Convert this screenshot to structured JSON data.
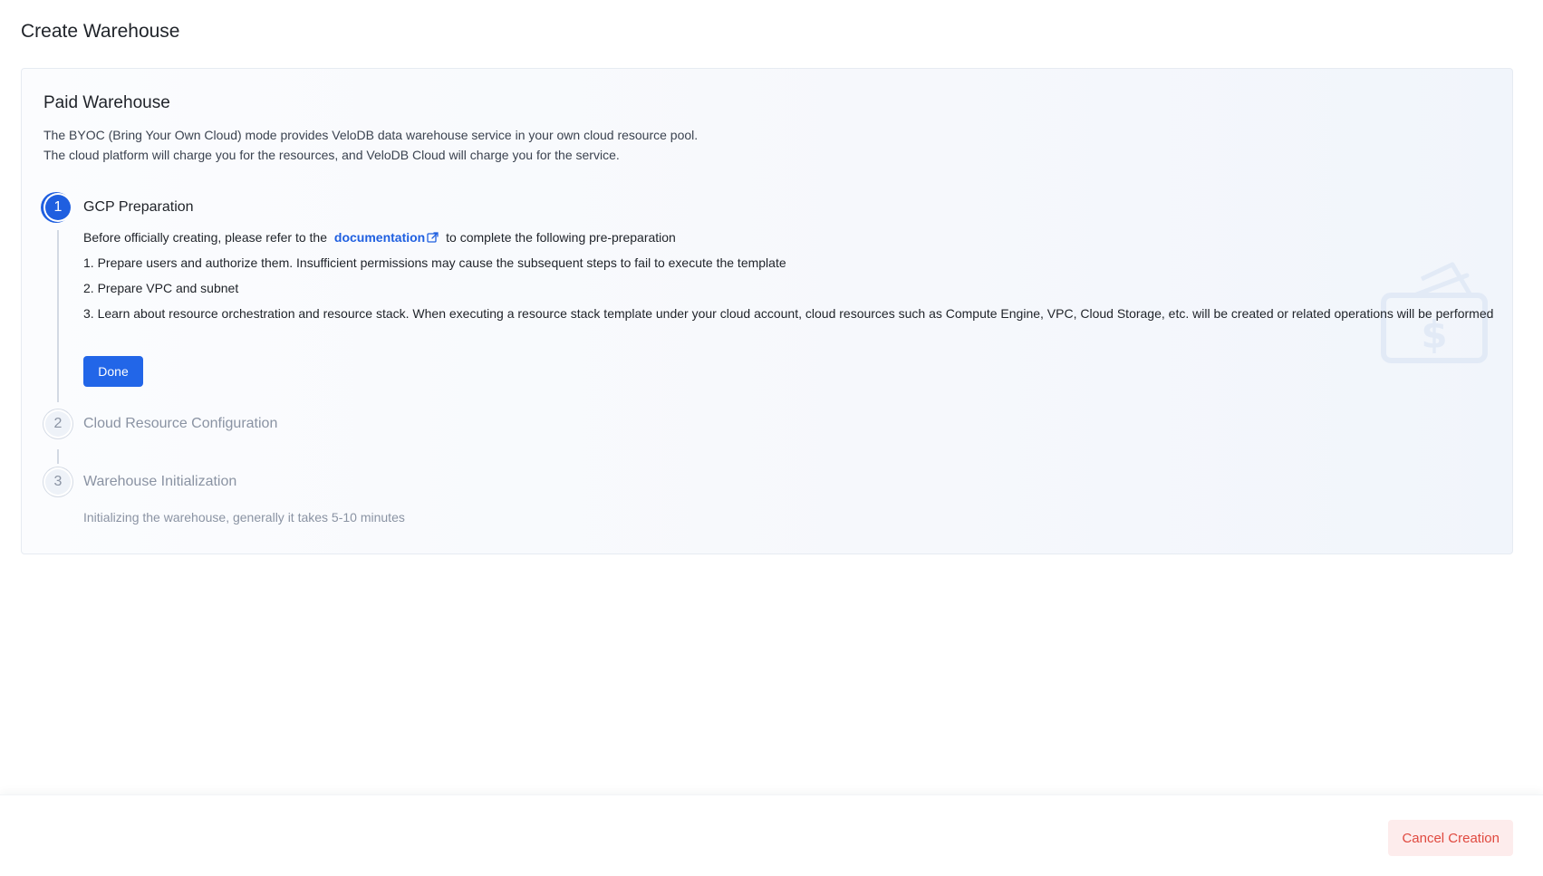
{
  "page": {
    "title": "Create Warehouse"
  },
  "card": {
    "title": "Paid Warehouse",
    "description": [
      "The BYOC (Bring Your Own Cloud) mode provides VeloDB data warehouse service in your own cloud resource pool.",
      "The cloud platform will charge you for the resources, and VeloDB Cloud will charge you for the service."
    ]
  },
  "steps": [
    {
      "number": "1",
      "title": "GCP Preparation",
      "status": "active",
      "intro_prefix": "Before officially creating, please refer to the",
      "link_label": "documentation",
      "intro_suffix": "to complete the following pre-preparation",
      "items": [
        "1. Prepare users and authorize them. Insufficient permissions may cause the subsequent steps to fail to execute the template",
        "2. Prepare VPC and subnet",
        "3. Learn about resource orchestration and resource stack. When executing a resource stack template under your cloud account, cloud resources such as Compute Engine, VPC, Cloud Storage, etc. will be created or related operations will be performed"
      ],
      "button_label": "Done"
    },
    {
      "number": "2",
      "title": "Cloud Resource Configuration",
      "status": "pending"
    },
    {
      "number": "3",
      "title": "Warehouse Initialization",
      "status": "pending",
      "note": "Initializing the warehouse, generally it takes 5-10 minutes"
    }
  ],
  "footer": {
    "cancel_label": "Cancel Creation"
  },
  "icons": {
    "external_link": "external-link-icon",
    "watermark": "wallet-dollar-icon"
  },
  "colors": {
    "primary": "#1f5fe0",
    "danger": "#e0493f",
    "danger_bg": "#fdecec",
    "muted": "#8a93a3"
  }
}
